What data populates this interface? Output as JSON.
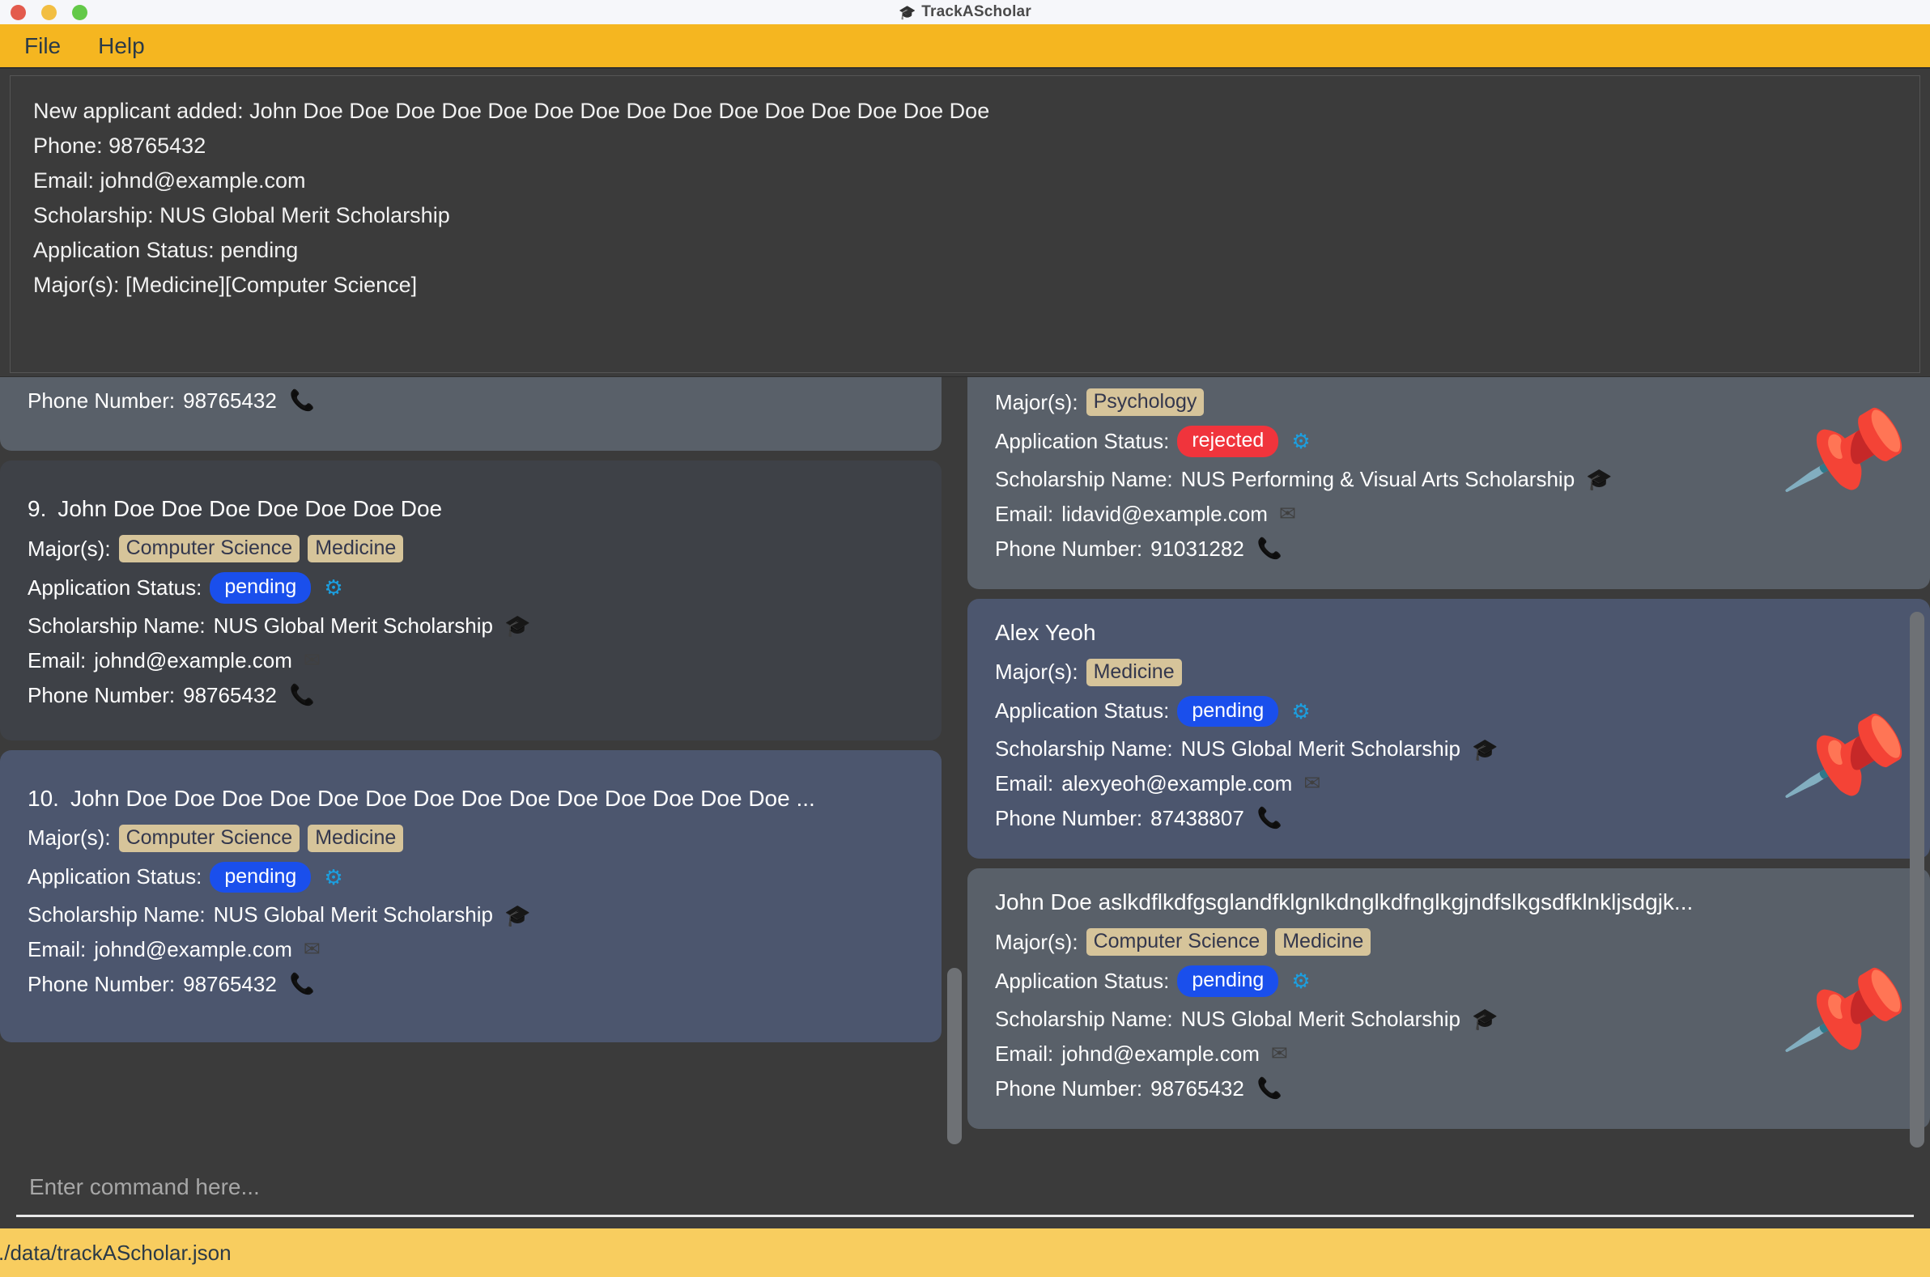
{
  "window": {
    "title": "TrackAScholar",
    "title_icon": "app-icon",
    "controls": [
      "close",
      "minimize",
      "maximize"
    ]
  },
  "menubar": {
    "items": [
      {
        "label": "File"
      },
      {
        "label": "Help"
      }
    ]
  },
  "result_display": {
    "lines": [
      "New applicant added: John Doe Doe Doe Doe Doe Doe Doe Doe Doe Doe Doe Doe Doe Doe Doe",
      "Phone: 98765432",
      "Email: johnd@example.com",
      "Scholarship: NUS Global Merit Scholarship",
      "Application Status: pending",
      "Major(s): [Medicine][Computer Science]"
    ]
  },
  "labels": {
    "majors": "Major(s):",
    "status": "Application Status:",
    "scholarship": "Scholarship Name:",
    "email": "Email:",
    "phone": "Phone Number:"
  },
  "left_panel": {
    "partial_top_card": {
      "phone_label": "Phone Number:",
      "phone": "98765432"
    },
    "cards": [
      {
        "index": "9.",
        "name": "John Doe Doe Doe Doe Doe Doe Doe",
        "majors": [
          "Computer Science",
          "Medicine"
        ],
        "status": "pending",
        "status_kind": "pending",
        "scholarship": "NUS Global Merit Scholarship",
        "email": "johnd@example.com",
        "phone": "98765432",
        "pinned": false,
        "theme": "dark"
      },
      {
        "index": "10.",
        "name": "John Doe Doe Doe Doe Doe Doe Doe Doe Doe Doe Doe Doe Doe Doe ...",
        "majors": [
          "Computer Science",
          "Medicine"
        ],
        "status": "pending",
        "status_kind": "pending",
        "scholarship": "NUS Global Merit Scholarship",
        "email": "johnd@example.com",
        "phone": "98765432",
        "pinned": false,
        "theme": "blue"
      }
    ]
  },
  "right_panel": {
    "partial_top_card": {
      "majors_label": "Major(s):",
      "majors": [
        "Psychology"
      ],
      "status": "rejected",
      "status_kind": "rejected",
      "scholarship": "NUS Performing & Visual Arts Scholarship",
      "email": "lidavid@example.com",
      "phone": "91031282",
      "pinned": true,
      "theme": "gray"
    },
    "cards": [
      {
        "name": "Alex Yeoh",
        "majors": [
          "Medicine"
        ],
        "status": "pending",
        "status_kind": "pending",
        "scholarship": "NUS Global Merit Scholarship",
        "email": "alexyeoh@example.com",
        "phone": "87438807",
        "pinned": true,
        "theme": "blue"
      },
      {
        "name": "John Doe aslkdflkdfgsglandfklgnlkdnglkdfnglkgjndfslkgsdfklnkljsdgjk...",
        "majors": [
          "Computer Science",
          "Medicine"
        ],
        "status": "pending",
        "status_kind": "pending",
        "scholarship": "NUS Global Merit Scholarship",
        "email": "johnd@example.com",
        "phone": "98765432",
        "pinned": true,
        "theme": "gray"
      }
    ]
  },
  "command_box": {
    "value": "",
    "placeholder": "Enter command here..."
  },
  "statusbar": {
    "path": "./data/trackAScholar.json"
  },
  "icons": {
    "status": "gear-network-icon",
    "scholarship": "graduation-cap-icon",
    "email": "envelope-icon",
    "phone": "telephone-icon",
    "pin": "pushpin-icon"
  },
  "colors": {
    "menubar": "#f5b620",
    "statusbar": "#f8cd5f",
    "tag": "#d6c49a",
    "pending": "#1a4fec",
    "rejected": "#f0343c",
    "card_gray": "#596069",
    "card_dark": "#3e4147",
    "card_blue": "#4c566e",
    "app_bg": "#3b3b3b"
  }
}
